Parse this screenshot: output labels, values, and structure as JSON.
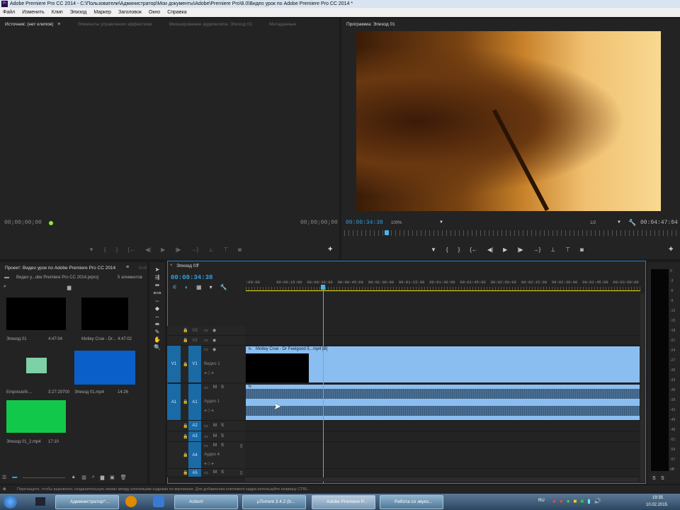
{
  "window": {
    "title": "Adobe Premiere Pro CC 2014 - C:\\Пользователи\\Администратор\\Мои документы\\Adobe\\Premiere Pro\\8.0\\Видео урок по Adobe Premiere Pro CC 2014 *",
    "app_badge": "Pr"
  },
  "menu": [
    "Файл",
    "Изменить",
    "Клип",
    "Эпизод",
    "Маркер",
    "Заголовок",
    "Окно",
    "Справка"
  ],
  "source_panel": {
    "tabs": [
      "Источник: (нет клипов)",
      "Элементы управления эффектами",
      "Микширование аудиоклипа: Эпизод 01",
      "Метаданные"
    ],
    "menu_icon": "≡",
    "timecode_in": "00;00;00;00",
    "timecode_out": "00;00;00;00"
  },
  "program_panel": {
    "tab": "Программа: Эпизод 01",
    "timecode": "00:00:34:38",
    "zoom": "100%",
    "resolution": "1/2",
    "duration": "00:04:47:04",
    "playhead_fraction": 0.121
  },
  "transport": {
    "marker": "▼",
    "in": "{",
    "out": "}",
    "go_in": "{←",
    "step_back": "◀|",
    "play": "▶",
    "step_fwd": "|▶",
    "go_out": "→}",
    "lift": "⊥",
    "extract": "⊤",
    "export": "◙",
    "add": "+"
  },
  "project_panel": {
    "tab": "Проект: Видео урок по Adobe Premiere Pro CC 2014",
    "extra_tab": "Биб",
    "menu_icon": "≡",
    "project_file": "Видео у...obe Premiere Pro CC 2014.prproj",
    "item_count": "5 элементов",
    "items": [
      {
        "name": "Эпизод 01",
        "duration": "4:47:04",
        "thumb": "#000000"
      },
      {
        "name": "Motley Crue - Dr...",
        "duration": "4:47:02",
        "thumb": "#000000"
      },
      {
        "name": "EmpresioN-...",
        "duration": "3:27:29700",
        "thumb": "audio"
      },
      {
        "name": "Эпизод 01.mp4",
        "duration": "14:26",
        "thumb": "#0a5fc8"
      },
      {
        "name": "Эпизод 01_2.mp4",
        "duration": "17:10",
        "thumb": "#12c84a"
      }
    ]
  },
  "tools": [
    "selection",
    "track-select",
    "ripple",
    "rolling",
    "rate-stretch",
    "razor",
    "slip",
    "slide",
    "pen",
    "hand",
    "zoom"
  ],
  "timeline": {
    "tab": "Эпизод 01",
    "menu_icon": "≡",
    "timecode": "00:00:34:38",
    "ruler": [
      ":00:00",
      "00:00:15:00",
      "00:00:30:00",
      "00:00:45:00",
      "00:01:00:00",
      "00:01:15:00",
      "00:01:30:00",
      "00:01:45:00",
      "00:02:00:00",
      "00:02:15:00",
      "00:02:30:00",
      "00:02:45:00",
      "00:03:00:00"
    ],
    "playhead_seconds": 34.6,
    "video_tracks": [
      {
        "id": "V3"
      },
      {
        "id": "V2"
      },
      {
        "id": "V1",
        "name": "Видео 1",
        "source": "V1"
      }
    ],
    "audio_tracks": [
      {
        "id": "A1",
        "name": "Аудио 1",
        "source": "A1"
      },
      {
        "id": "A2"
      },
      {
        "id": "A3"
      },
      {
        "id": "A4",
        "name": "Аудио 4"
      },
      {
        "id": "A5"
      }
    ],
    "mute": "M",
    "solo": "S",
    "fx_badge": "fx",
    "video_clip": "Motley Crue - Dr Feelgood 5...mp4 [В]"
  },
  "meters": {
    "scale": [
      "0",
      "-3",
      "-6",
      "-9",
      "-12",
      "-15",
      "-18",
      "-21",
      "-24",
      "-27",
      "-30",
      "-33",
      "-36",
      "-39",
      "-42",
      "-45",
      "-48",
      "-51",
      "-54",
      "-57",
      "dB"
    ],
    "solo": [
      "S",
      "S"
    ]
  },
  "status_bar": "Перетащите, чтобы выровнять соединительную линию между ключевыми кадрами по вертикали. Для добавления ключевого кадра используйте клавишу CTRL.",
  "taskbar": {
    "buttons": [
      "Администратор^...",
      "Action!",
      "µTorrent 3.4.2 (b...",
      "Adobe Premiere P...",
      "Работа со звуко..."
    ],
    "lang": "RU",
    "time": "19:35",
    "date": "10.02.2015"
  }
}
